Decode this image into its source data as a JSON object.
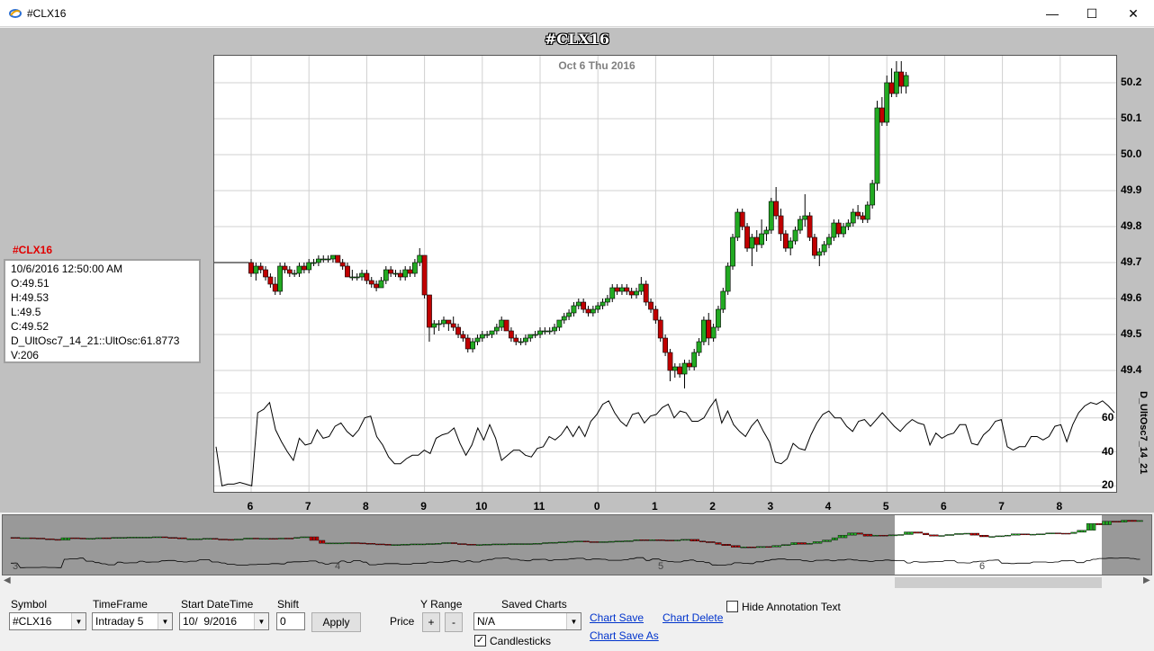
{
  "window": {
    "title": "#CLX16",
    "minimize_glyph": "—",
    "maximize_glyph": "☐",
    "close_glyph": "✕"
  },
  "chart": {
    "title": "#CLX16",
    "date_label": "Oct 6 Thu 2016",
    "oscillator_label": "D_UltOsc7_14_21",
    "price_axis_ticks": [
      "50.2",
      "50.1",
      "50.0",
      "49.9",
      "49.8",
      "49.7",
      "49.6",
      "49.5",
      "49.4"
    ],
    "osc_axis_ticks": [
      "60",
      "40",
      "20"
    ],
    "x_axis_ticks": [
      "6",
      "7",
      "8",
      "9",
      "10",
      "11",
      "0",
      "1",
      "2",
      "3",
      "4",
      "5",
      "6",
      "7",
      "8"
    ],
    "colors": {
      "up": "#22aa22",
      "down": "#c00000",
      "grid": "#d0d0d0"
    }
  },
  "chart_data": {
    "type": "candlestick",
    "title": "#CLX16",
    "x_label": "Oct 6 Thu 2016",
    "ylim": [
      49.35,
      50.26
    ],
    "osc_ylim": [
      17,
      72
    ],
    "bars_per_hour": 12,
    "x_hours": [
      "6",
      "7",
      "8",
      "9",
      "10",
      "11",
      "0",
      "1",
      "2",
      "3",
      "4",
      "5",
      "6",
      "7",
      "8"
    ],
    "series": [
      {
        "name": "#CLX16",
        "ohlc": [
          [
            49.7,
            49.71,
            49.66,
            49.67
          ],
          [
            49.67,
            49.7,
            49.65,
            49.69
          ],
          [
            49.69,
            49.7,
            49.67,
            49.68
          ],
          [
            49.68,
            49.69,
            49.65,
            49.66
          ],
          [
            49.66,
            49.67,
            49.63,
            49.64
          ],
          [
            49.64,
            49.66,
            49.61,
            49.62
          ],
          [
            49.62,
            49.7,
            49.61,
            49.69
          ],
          [
            49.69,
            49.7,
            49.67,
            49.68
          ],
          [
            49.68,
            49.69,
            49.66,
            49.67
          ],
          [
            49.67,
            49.68,
            49.66,
            49.67
          ],
          [
            49.67,
            49.7,
            49.66,
            49.69
          ],
          [
            49.69,
            49.7,
            49.67,
            49.68
          ],
          [
            49.68,
            49.71,
            49.67,
            49.7
          ],
          [
            49.7,
            49.71,
            49.69,
            49.7
          ],
          [
            49.7,
            49.72,
            49.69,
            49.71
          ],
          [
            49.71,
            49.72,
            49.7,
            49.71
          ],
          [
            49.71,
            49.72,
            49.7,
            49.71
          ],
          [
            49.71,
            49.72,
            49.7,
            49.72
          ],
          [
            49.72,
            49.72,
            49.7,
            49.7
          ],
          [
            49.7,
            49.71,
            49.68,
            49.69
          ],
          [
            49.69,
            49.7,
            49.66,
            49.66
          ],
          [
            49.66,
            49.68,
            49.65,
            49.66
          ],
          [
            49.66,
            49.67,
            49.65,
            49.66
          ],
          [
            49.66,
            49.68,
            49.65,
            49.67
          ],
          [
            49.67,
            49.68,
            49.64,
            49.65
          ],
          [
            49.65,
            49.66,
            49.63,
            49.64
          ],
          [
            49.64,
            49.65,
            49.62,
            49.63
          ],
          [
            49.63,
            49.66,
            49.63,
            49.65
          ],
          [
            49.65,
            49.69,
            49.64,
            49.68
          ],
          [
            49.68,
            49.69,
            49.66,
            49.67
          ],
          [
            49.67,
            49.68,
            49.66,
            49.67
          ],
          [
            49.67,
            49.68,
            49.65,
            49.66
          ],
          [
            49.66,
            49.69,
            49.65,
            49.68
          ],
          [
            49.68,
            49.69,
            49.66,
            49.67
          ],
          [
            49.67,
            49.71,
            49.66,
            49.7
          ],
          [
            49.7,
            49.74,
            49.69,
            49.72
          ],
          [
            49.72,
            49.72,
            49.6,
            49.61
          ],
          [
            49.61,
            49.61,
            49.48,
            49.52
          ],
          [
            49.52,
            49.54,
            49.5,
            49.53
          ],
          [
            49.53,
            49.54,
            49.51,
            49.53
          ],
          [
            49.53,
            49.55,
            49.52,
            49.54
          ],
          [
            49.54,
            49.54,
            49.51,
            49.53
          ],
          [
            49.53,
            49.55,
            49.51,
            49.52
          ],
          [
            49.52,
            49.53,
            49.49,
            49.5
          ],
          [
            49.5,
            49.51,
            49.48,
            49.49
          ],
          [
            49.49,
            49.5,
            49.45,
            49.46
          ],
          [
            49.46,
            49.49,
            49.45,
            49.48
          ],
          [
            49.48,
            49.5,
            49.47,
            49.49
          ],
          [
            49.49,
            49.51,
            49.48,
            49.5
          ],
          [
            49.5,
            49.51,
            49.49,
            49.5
          ],
          [
            49.5,
            49.51,
            49.49,
            49.51
          ],
          [
            49.51,
            49.53,
            49.5,
            49.52
          ],
          [
            49.52,
            49.55,
            49.51,
            49.54
          ],
          [
            49.54,
            49.54,
            49.51,
            49.51
          ],
          [
            49.51,
            49.52,
            49.48,
            49.49
          ],
          [
            49.49,
            49.5,
            49.47,
            49.48
          ],
          [
            49.48,
            49.49,
            49.47,
            49.48
          ],
          [
            49.48,
            49.5,
            49.47,
            49.49
          ],
          [
            49.49,
            49.5,
            49.48,
            49.5
          ],
          [
            49.5,
            49.51,
            49.49,
            49.5
          ],
          [
            49.5,
            49.52,
            49.49,
            49.51
          ],
          [
            49.51,
            49.52,
            49.5,
            49.51
          ],
          [
            49.51,
            49.52,
            49.5,
            49.51
          ],
          [
            49.51,
            49.53,
            49.5,
            49.52
          ],
          [
            49.52,
            49.54,
            49.51,
            49.54
          ],
          [
            49.54,
            49.56,
            49.53,
            49.55
          ],
          [
            49.55,
            49.57,
            49.54,
            49.56
          ],
          [
            49.56,
            49.59,
            49.55,
            49.58
          ],
          [
            49.58,
            49.6,
            49.57,
            49.59
          ],
          [
            49.59,
            49.6,
            49.56,
            49.57
          ],
          [
            49.57,
            49.58,
            49.55,
            49.56
          ],
          [
            49.56,
            49.58,
            49.55,
            49.57
          ],
          [
            49.57,
            49.59,
            49.56,
            49.58
          ],
          [
            49.58,
            49.6,
            49.57,
            49.59
          ],
          [
            49.59,
            49.61,
            49.58,
            49.6
          ],
          [
            49.6,
            49.64,
            49.59,
            49.63
          ],
          [
            49.63,
            49.64,
            49.61,
            49.62
          ],
          [
            49.62,
            49.64,
            49.61,
            49.63
          ],
          [
            49.63,
            49.64,
            49.61,
            49.62
          ],
          [
            49.62,
            49.63,
            49.6,
            49.61
          ],
          [
            49.61,
            49.63,
            49.6,
            49.62
          ],
          [
            49.62,
            49.66,
            49.61,
            49.64
          ],
          [
            49.64,
            49.65,
            49.58,
            49.59
          ],
          [
            49.59,
            49.6,
            49.56,
            49.57
          ],
          [
            49.57,
            49.58,
            49.53,
            49.54
          ],
          [
            49.54,
            49.55,
            49.48,
            49.49
          ],
          [
            49.49,
            49.5,
            49.44,
            49.45
          ],
          [
            49.45,
            49.46,
            49.37,
            49.4
          ],
          [
            49.4,
            49.42,
            49.38,
            49.41
          ],
          [
            49.41,
            49.42,
            49.38,
            49.39
          ],
          [
            49.39,
            49.43,
            49.35,
            49.42
          ],
          [
            49.42,
            49.43,
            49.4,
            49.41
          ],
          [
            49.41,
            49.46,
            49.4,
            49.45
          ],
          [
            49.45,
            49.49,
            49.44,
            49.48
          ],
          [
            49.48,
            49.55,
            49.47,
            49.54
          ],
          [
            49.54,
            49.56,
            49.47,
            49.49
          ],
          [
            49.49,
            49.53,
            49.48,
            49.52
          ],
          [
            49.52,
            49.58,
            49.51,
            49.57
          ],
          [
            49.57,
            49.63,
            49.56,
            49.62
          ],
          [
            49.62,
            49.7,
            49.61,
            49.69
          ],
          [
            49.69,
            49.78,
            49.68,
            49.77
          ],
          [
            49.77,
            49.85,
            49.76,
            49.84
          ],
          [
            49.84,
            49.85,
            49.79,
            49.8
          ],
          [
            49.8,
            49.81,
            49.73,
            49.74
          ],
          [
            49.74,
            49.78,
            49.69,
            49.77
          ],
          [
            49.77,
            49.79,
            49.73,
            49.75
          ],
          [
            49.75,
            49.82,
            49.74,
            49.78
          ],
          [
            49.78,
            49.8,
            49.76,
            49.79
          ],
          [
            49.79,
            49.88,
            49.78,
            49.87
          ],
          [
            49.87,
            49.91,
            49.82,
            49.83
          ],
          [
            49.83,
            49.85,
            49.76,
            49.78
          ],
          [
            49.78,
            49.79,
            49.73,
            49.74
          ],
          [
            49.74,
            49.77,
            49.72,
            49.76
          ],
          [
            49.76,
            49.8,
            49.75,
            49.79
          ],
          [
            49.79,
            49.83,
            49.78,
            49.82
          ],
          [
            49.82,
            49.89,
            49.8,
            49.83
          ],
          [
            49.83,
            49.84,
            49.76,
            49.77
          ],
          [
            49.77,
            49.78,
            49.71,
            49.72
          ],
          [
            49.72,
            49.74,
            49.69,
            49.73
          ],
          [
            49.73,
            49.76,
            49.72,
            49.75
          ],
          [
            49.75,
            49.78,
            49.74,
            49.77
          ],
          [
            49.77,
            49.82,
            49.76,
            49.81
          ],
          [
            49.81,
            49.82,
            49.77,
            49.78
          ],
          [
            49.78,
            49.81,
            49.77,
            49.8
          ],
          [
            49.8,
            49.82,
            49.79,
            49.81
          ],
          [
            49.81,
            49.85,
            49.8,
            49.84
          ],
          [
            49.84,
            49.86,
            49.82,
            49.83
          ],
          [
            49.83,
            49.84,
            49.81,
            49.82
          ],
          [
            49.82,
            49.87,
            49.81,
            49.86
          ],
          [
            49.86,
            49.93,
            49.85,
            49.92
          ],
          [
            49.92,
            50.15,
            49.9,
            50.13
          ],
          [
            50.13,
            50.16,
            50.08,
            50.09
          ],
          [
            50.09,
            50.22,
            50.08,
            50.2
          ],
          [
            50.2,
            50.24,
            50.16,
            50.17
          ],
          [
            50.17,
            50.26,
            50.16,
            50.23
          ],
          [
            50.23,
            50.26,
            50.17,
            50.19
          ],
          [
            50.19,
            50.23,
            50.17,
            50.22
          ]
        ]
      },
      {
        "name": "D_UltOsc7_14_21",
        "values": [
          43,
          20,
          21,
          21,
          22,
          21,
          20,
          63,
          65,
          69,
          53,
          46,
          40,
          35,
          48,
          44,
          45,
          53,
          48,
          49,
          55,
          57,
          52,
          49,
          53,
          60,
          61,
          49,
          44,
          37,
          33,
          33,
          36,
          38,
          38,
          41,
          39,
          48,
          50,
          51,
          54,
          45,
          38,
          44,
          54,
          47,
          56,
          48,
          35,
          38,
          41,
          41,
          38,
          37,
          42,
          43,
          49,
          47,
          50,
          55,
          49,
          55,
          49,
          58,
          62,
          68,
          70,
          63,
          58,
          55,
          62,
          63,
          57,
          61,
          62,
          66,
          68,
          60,
          64,
          63,
          58,
          58,
          60,
          66,
          71,
          57,
          64,
          56,
          52,
          49,
          55,
          59,
          52,
          46,
          34,
          33,
          36,
          45,
          42,
          41,
          50,
          57,
          62,
          64,
          60,
          60,
          55,
          52,
          58,
          59,
          55,
          59,
          63,
          59,
          55,
          52,
          56,
          59,
          57,
          56,
          44,
          51,
          48,
          50,
          51,
          56,
          56,
          45,
          44,
          50,
          53,
          58,
          59,
          43,
          41,
          43,
          43,
          49,
          49,
          47,
          49,
          55,
          56,
          46,
          56,
          63,
          67,
          69,
          68,
          70,
          67,
          63
        ]
      }
    ]
  },
  "info_panel": {
    "symbol": "#CLX16",
    "datetime": "10/6/2016 12:50:00 AM",
    "open": "O:49.51",
    "high": "H:49.53",
    "low": "L:49.5",
    "close": "C:49.52",
    "oscillator": "D_UltOsc7_14_21::UltOsc:61.8773",
    "volume": "V:206"
  },
  "navigator": {
    "ticks": [
      "3",
      "4",
      "5",
      "6"
    ]
  },
  "controls": {
    "symbol_label": "Symbol",
    "symbol_value": "#CLX16",
    "timeframe_label": "TimeFrame",
    "timeframe_value": "Intraday 5",
    "start_label": "Start DateTime",
    "start_value": "10/  9/2016",
    "shift_label": "Shift",
    "shift_value": "0",
    "apply_label": "Apply",
    "yrange_label": "Y Range",
    "price_label": "Price",
    "plus_label": "+",
    "minus_label": "-",
    "saved_label": "Saved Charts",
    "saved_value": "N/A",
    "chart_save": "Chart Save",
    "chart_delete": "Chart Delete",
    "chart_save_as": "Chart Save As",
    "candlesticks_label": "Candlesticks",
    "hide_annotation_label": "Hide Annotation Text"
  }
}
